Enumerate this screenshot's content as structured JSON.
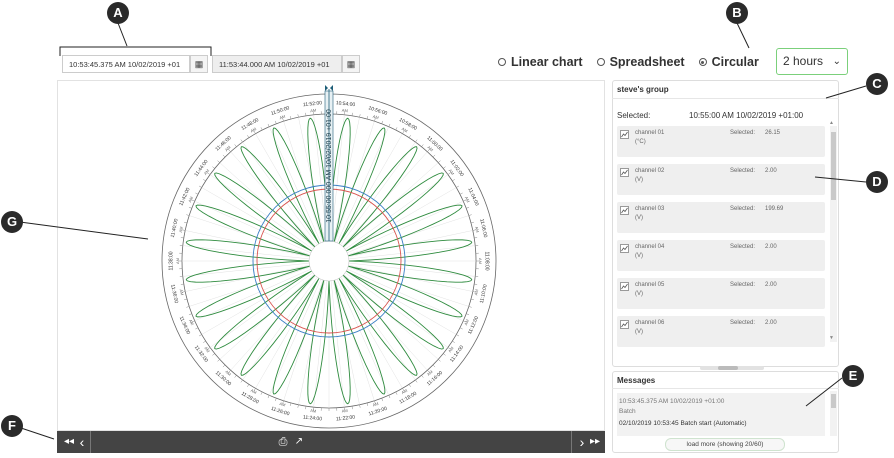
{
  "time_range": {
    "start": "10:53:45.375 AM 10/02/2019 +01",
    "end": "11:53:44.000 AM 10/02/2019 +01",
    "calendar_icon": "calendar-icon"
  },
  "view_mode": {
    "options": [
      "Linear chart",
      "Spreadsheet",
      "Circular"
    ],
    "selected": "Circular",
    "duration": "2 hours"
  },
  "chart": {
    "cursor_label": "10:55:00.000 AM 10/02/2019 +01:00",
    "time_ticks": [
      "10:54:00",
      "10:56:00",
      "10:58:00",
      "11:00:00",
      "11:02:00",
      "11:04:00",
      "11:06:00",
      "11:08:00",
      "11:10:00",
      "11:12:00",
      "11:14:00",
      "11:16:00",
      "11:18:00",
      "11:20:00",
      "11:22:00",
      "11:24:00",
      "11:26:00",
      "11:28:00",
      "11:30:00",
      "11:32:00",
      "11:34:00",
      "11:36:00",
      "11:38:00",
      "11:40:00",
      "11:42:00",
      "11:44:00",
      "11:46:00",
      "11:48:00",
      "11:50:00",
      "11:52:00"
    ],
    "tick_suffix": "AM",
    "series_colors": {
      "channel_01": "#2e8b3e",
      "ring_red": "#d9534f",
      "ring_blue": "#3b7fc4",
      "cursor": "#1e5e78"
    }
  },
  "bottom_bar": {
    "rewind_icon": "rewind-icon",
    "prev_icon": "chevron-left-icon",
    "print_icon": "print-icon",
    "export_icon": "external-link-icon",
    "next_icon": "chevron-right-icon",
    "forward_icon": "fast-forward-icon",
    "rewind_glyph": "◂◂",
    "prev_glyph": "‹",
    "print_glyph": "⎙",
    "export_glyph": "↗",
    "next_glyph": "›",
    "forward_glyph": "▸▸"
  },
  "group": {
    "name": "steve's group",
    "selected_label": "Selected:",
    "selected_value": "10:55:00 AM 10/02/2019 +01:00",
    "channels": [
      {
        "name": "channel 01",
        "unit": "(°C)",
        "sel_label": "Selected:",
        "value": "26.15"
      },
      {
        "name": "channel 02",
        "unit": "(V)",
        "sel_label": "Selected:",
        "value": "2.00"
      },
      {
        "name": "channel 03",
        "unit": "(V)",
        "sel_label": "Selected:",
        "value": "199.69"
      },
      {
        "name": "channel 04",
        "unit": "(V)",
        "sel_label": "Selected:",
        "value": "2.00"
      },
      {
        "name": "channel 05",
        "unit": "(V)",
        "sel_label": "Selected:",
        "value": "2.00"
      },
      {
        "name": "channel 06",
        "unit": "(V)",
        "sel_label": "Selected:",
        "value": "2.00"
      }
    ]
  },
  "messages": {
    "title": "Messages",
    "items": [
      {
        "time": "10:53:45.375 AM 10/02/2019 +01:00",
        "type": "Batch",
        "text": "02/10/2019 10:53:45 Batch start (Automatic)"
      }
    ],
    "load_more": "load more (showing 20/60)"
  },
  "callouts": [
    "A",
    "B",
    "C",
    "D",
    "E",
    "F",
    "G"
  ]
}
